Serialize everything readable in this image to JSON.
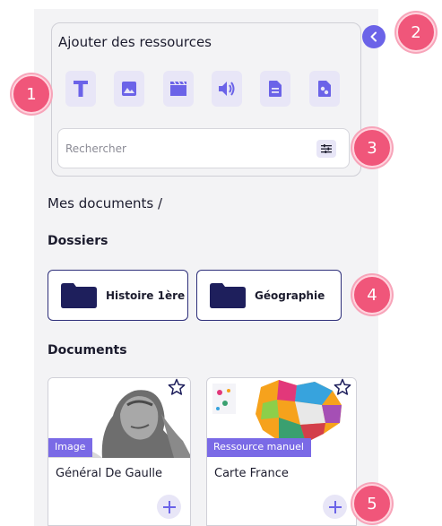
{
  "add_resources": {
    "title": "Ajouter des ressources",
    "buttons": [
      {
        "name": "text-resource-button",
        "icon": "text-icon"
      },
      {
        "name": "image-resource-button",
        "icon": "image-icon"
      },
      {
        "name": "video-resource-button",
        "icon": "clapperboard-icon"
      },
      {
        "name": "audio-resource-button",
        "icon": "speaker-icon"
      },
      {
        "name": "document-resource-button",
        "icon": "document-icon"
      },
      {
        "name": "file-resource-button",
        "icon": "shared-file-icon"
      }
    ],
    "search_placeholder": "Rechercher",
    "filter_icon": "filter-sliders-icon"
  },
  "collapse_icon": "chevron-left-icon",
  "breadcrumb": "Mes documents /",
  "folders_section": {
    "title": "Dossiers",
    "folders": [
      {
        "label": "Histoire 1ère",
        "icon": "folder-icon"
      },
      {
        "label": "Géographie",
        "icon": "folder-icon"
      }
    ]
  },
  "documents_section": {
    "title": "Documents",
    "documents": [
      {
        "title": "Général De Gaulle",
        "tag": "Image",
        "icon_star": "star-outline-icon",
        "icon_add": "plus-icon"
      },
      {
        "title": "Carte France",
        "tag": "Ressource manuel",
        "icon_star": "star-outline-icon",
        "icon_add": "plus-icon"
      }
    ]
  },
  "callouts": [
    "1",
    "2",
    "3",
    "4",
    "5"
  ],
  "colors": {
    "accent": "#6b63e8",
    "tag": "#7a6ae6",
    "icon_bg": "#e8e6f7",
    "callout": "#f0567a",
    "folder_fill": "#1e1f5c"
  }
}
